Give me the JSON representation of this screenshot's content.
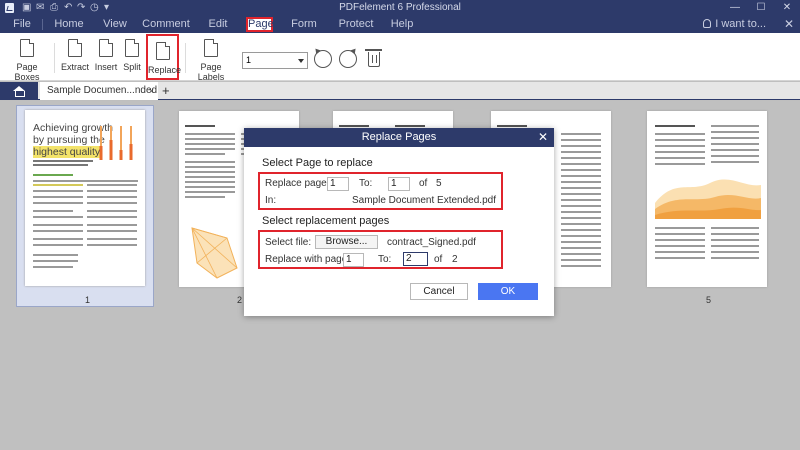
{
  "window": {
    "title": "PDFelement 6 Professional"
  },
  "menu": {
    "items": [
      "File",
      "Home",
      "View",
      "Comment",
      "Edit",
      "Page",
      "Form",
      "Protect",
      "Help"
    ],
    "active": "Page",
    "search_label": "I want to..."
  },
  "toolbar": {
    "page_boxes": "Page Boxes",
    "extract": "Extract",
    "insert": "Insert",
    "split": "Split",
    "replace": "Replace",
    "page_labels": "Page Labels",
    "page_select_value": "1"
  },
  "tabs": {
    "doc_tab_label": "Sample Documen...nded",
    "close_glyph": "×",
    "add_glyph": "+"
  },
  "thumbnail1": {
    "heading_line1": "Achieving growth",
    "heading_line2": "by pursuing the",
    "heading_line3": "highest quality."
  },
  "pages": {
    "visible_numbers": [
      "1",
      "2",
      "5"
    ]
  },
  "dialog": {
    "title": "Replace Pages",
    "section1_title": "Select Page to replace",
    "replace_page_label": "Replace page:",
    "replace_from": "1",
    "to_label": "To:",
    "replace_to": "1",
    "of_label": "of",
    "total_pages": "5",
    "in_label": "In:",
    "in_file": "Sample Document Extended.pdf",
    "section2_title": "Select replacement pages",
    "select_file_label": "Select file:",
    "browse_label": "Browse...",
    "selected_file": "contract_Signed.pdf",
    "replace_with_label": "Replace with page:",
    "with_from": "1",
    "with_to_label": "To:",
    "with_to": "2",
    "with_of_label": "of",
    "with_total": "2",
    "cancel_label": "Cancel",
    "ok_label": "OK"
  },
  "colors": {
    "titlebar": "#2d3a6a",
    "highlight_red": "#e0242c",
    "ok_button": "#4a76f2",
    "chart_orange": "#f5a646",
    "text_yellow_highlight": "#f3e36a"
  }
}
